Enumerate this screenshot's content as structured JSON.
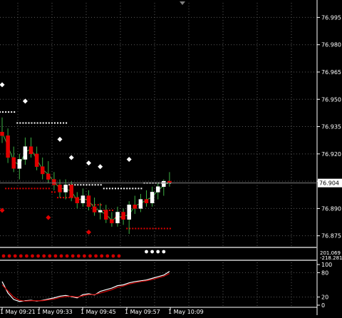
{
  "chart_data": [
    {
      "type": "candlestick",
      "panel": "main",
      "y_axis_ticks": [
        "76.995",
        "76.980",
        "76.965",
        "76.950",
        "76.935",
        "76.920",
        "76.905",
        "76.890",
        "76.875"
      ],
      "ylim": [
        76.869,
        77.003
      ],
      "current_price": "76.904",
      "grid": true,
      "candles": [
        {
          "o": 76.932,
          "h": 76.94,
          "l": 76.926,
          "c": 76.93
        },
        {
          "o": 76.93,
          "h": 76.934,
          "l": 76.915,
          "c": 76.918
        },
        {
          "o": 76.918,
          "h": 76.924,
          "l": 76.91,
          "c": 76.912
        },
        {
          "o": 76.912,
          "h": 76.92,
          "l": 76.906,
          "c": 76.917
        },
        {
          "o": 76.917,
          "h": 76.929,
          "l": 76.914,
          "c": 76.924
        },
        {
          "o": 76.924,
          "h": 76.929,
          "l": 76.918,
          "c": 76.92
        },
        {
          "o": 76.92,
          "h": 76.924,
          "l": 76.911,
          "c": 76.913
        },
        {
          "o": 76.913,
          "h": 76.918,
          "l": 76.906,
          "c": 76.909
        },
        {
          "o": 76.909,
          "h": 76.916,
          "l": 76.904,
          "c": 76.906
        },
        {
          "o": 76.906,
          "h": 76.91,
          "l": 76.9,
          "c": 76.903
        },
        {
          "o": 76.903,
          "h": 76.906,
          "l": 76.896,
          "c": 76.899
        },
        {
          "o": 76.899,
          "h": 76.906,
          "l": 76.895,
          "c": 76.903
        },
        {
          "o": 76.903,
          "h": 76.905,
          "l": 76.894,
          "c": 76.896
        },
        {
          "o": 76.896,
          "h": 76.899,
          "l": 76.89,
          "c": 76.893
        },
        {
          "o": 76.893,
          "h": 76.901,
          "l": 76.891,
          "c": 76.897
        },
        {
          "o": 76.897,
          "h": 76.9,
          "l": 76.889,
          "c": 76.891
        },
        {
          "o": 76.891,
          "h": 76.896,
          "l": 76.886,
          "c": 76.888
        },
        {
          "o": 76.888,
          "h": 76.893,
          "l": 76.884,
          "c": 76.889
        },
        {
          "o": 76.889,
          "h": 76.892,
          "l": 76.882,
          "c": 76.884
        },
        {
          "o": 76.884,
          "h": 76.888,
          "l": 76.88,
          "c": 76.882
        },
        {
          "o": 76.882,
          "h": 76.891,
          "l": 76.88,
          "c": 76.888
        },
        {
          "o": 76.888,
          "h": 76.89,
          "l": 76.881,
          "c": 76.884
        },
        {
          "o": 76.884,
          "h": 76.894,
          "l": 76.876,
          "c": 76.892
        },
        {
          "o": 76.892,
          "h": 76.897,
          "l": 76.887,
          "c": 76.89
        },
        {
          "o": 76.89,
          "h": 76.898,
          "l": 76.888,
          "c": 76.895
        },
        {
          "o": 76.895,
          "h": 76.9,
          "l": 76.891,
          "c": 76.893
        },
        {
          "o": 76.893,
          "h": 76.902,
          "l": 76.891,
          "c": 76.899
        },
        {
          "o": 76.899,
          "h": 76.904,
          "l": 76.895,
          "c": 76.902
        },
        {
          "o": 76.902,
          "h": 76.906,
          "l": 76.897,
          "c": 76.905
        },
        {
          "o": 76.905,
          "h": 76.91,
          "l": 76.902,
          "c": 76.904
        }
      ],
      "step_support": [
        76.901,
        76.901,
        76.901,
        76.901,
        76.901,
        76.901,
        76.901,
        76.901,
        76.901,
        76.899,
        76.896,
        76.896,
        76.896,
        76.896,
        76.895,
        76.895,
        76.892,
        76.892,
        76.889,
        76.889,
        76.885,
        76.885,
        76.879,
        76.879,
        76.879,
        76.879,
        76.879,
        76.879,
        76.879,
        76.879
      ],
      "step_resistance": [
        76.943,
        76.943,
        76.943,
        76.937,
        76.937,
        76.937,
        76.937,
        76.937,
        76.937,
        76.937,
        76.937,
        76.937,
        76.903,
        76.903,
        76.903,
        76.903,
        76.903,
        76.903,
        76.901,
        76.901,
        76.901,
        76.901,
        76.901,
        76.901,
        76.901,
        76.904,
        76.904,
        76.904,
        76.904,
        76.904
      ],
      "fractal_up": [
        {
          "i": 0,
          "v": 76.958
        },
        {
          "i": 4,
          "v": 76.949
        },
        {
          "i": 10,
          "v": 76.928
        },
        {
          "i": 12,
          "v": 76.918
        },
        {
          "i": 15,
          "v": 76.915
        },
        {
          "i": 17,
          "v": 76.913
        },
        {
          "i": 22,
          "v": 76.917
        }
      ],
      "fractal_down": [
        {
          "i": 0,
          "v": 76.889
        },
        {
          "i": 8,
          "v": 76.885
        },
        {
          "i": 15,
          "v": 76.877
        }
      ],
      "time_labels": [
        "1 May 09:21",
        "1 May 09:33",
        "1 May 09:45",
        "1 May 09:57",
        "1 May 10:09"
      ]
    },
    {
      "type": "dots",
      "panel": "indicator-1",
      "y_axis_ticks": [
        "201.069",
        "-218.281"
      ],
      "series": [
        {
          "color": "#d00000",
          "values": [
            1,
            1,
            1,
            1,
            1,
            1,
            1,
            1,
            1,
            1,
            1,
            1,
            1,
            1,
            1,
            1,
            1,
            1,
            1,
            1,
            1,
            0,
            0,
            0,
            0,
            0,
            0,
            0,
            0,
            0
          ]
        },
        {
          "color": "#ffffff",
          "values": [
            0,
            0,
            0,
            0,
            0,
            0,
            0,
            0,
            0,
            0,
            0,
            0,
            0,
            0,
            0,
            0,
            0,
            0,
            0,
            0,
            0,
            0,
            0,
            0,
            0,
            1,
            1,
            1,
            1,
            0
          ]
        }
      ]
    },
    {
      "type": "line",
      "panel": "indicator-2",
      "y_axis_ticks": [
        "100",
        "80",
        "20",
        "0"
      ],
      "ylim": [
        0,
        100
      ],
      "series": [
        {
          "name": "",
          "color": "#ffffff",
          "values": [
            58,
            30,
            14,
            9,
            11,
            12,
            10,
            12,
            15,
            18,
            22,
            24,
            21,
            18,
            26,
            28,
            25,
            34,
            38,
            42,
            48,
            50,
            55,
            58,
            60,
            62,
            66,
            70,
            74,
            83
          ]
        },
        {
          "name": "",
          "color": "#d00000",
          "values": [
            50,
            35,
            20,
            12,
            10,
            11,
            11,
            11,
            13,
            15,
            19,
            21,
            22,
            20,
            23,
            26,
            26,
            30,
            34,
            38,
            44,
            47,
            52,
            55,
            58,
            60,
            63,
            67,
            71,
            78
          ]
        }
      ]
    }
  ]
}
